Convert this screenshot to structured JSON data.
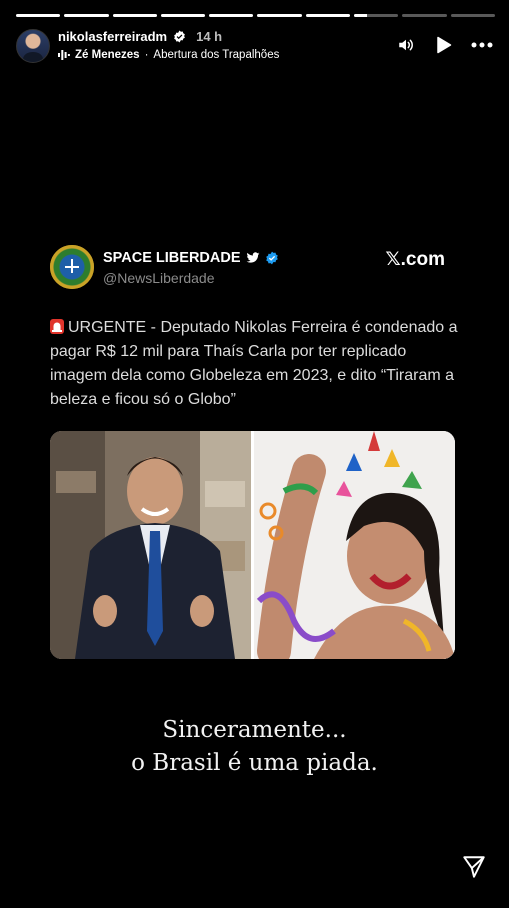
{
  "story": {
    "segments": [
      1,
      1,
      1,
      1,
      1,
      1,
      1,
      0.3,
      0,
      0
    ],
    "username": "nikolasferreiradm",
    "time": "14 h",
    "music_artist": "Zé Menezes",
    "music_separator": "·",
    "music_title": "Abertura dos Trapalhões",
    "controls": [
      "volume-icon",
      "play-icon",
      "more-icon"
    ],
    "send_icon": "send-icon"
  },
  "tweet": {
    "account_name": "SPACE LIBERDADE",
    "handle": "@NewsLiberdade",
    "source": "𝕏.com",
    "body": "URGENTE - Deputado Nikolas Ferreira é condenado a pagar R$ 12 mil para Thaís Carla por ter replicado imagem dela como Globeleza em 2023, e dito “Tiraram a beleza e ficou só o Globo”"
  },
  "caption": {
    "line1": "Sinceramente...",
    "line2": "o Brasil é uma piada."
  },
  "colors": {
    "background": "#000000",
    "verified_blue": "#1d9bf0",
    "handle_gray": "#8b8b8b"
  }
}
